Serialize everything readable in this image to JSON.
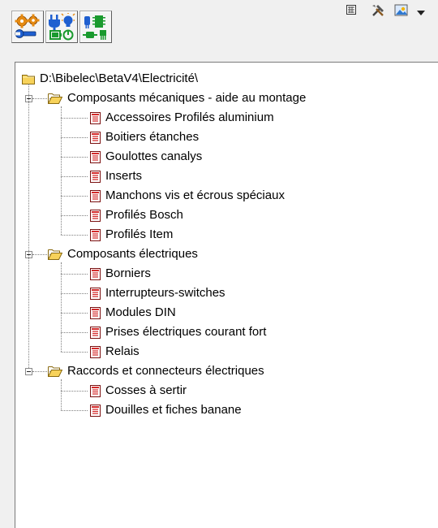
{
  "tree": {
    "root": {
      "label": "D:\\Bibelec\\BetaV4\\Electricité\\",
      "icon": "folder-icon"
    },
    "groups": [
      {
        "label": "Composants mécaniques - aide au montage",
        "icon": "folder-open-icon",
        "expanded": true,
        "items": [
          "Accessoires Profilés aluminium",
          "Boitiers étanches",
          "Goulottes canalys",
          "Inserts",
          "Manchons vis et écrous spéciaux",
          "Profilés Bosch",
          "Profilés Item"
        ]
      },
      {
        "label": "Composants électriques",
        "icon": "folder-open-icon",
        "expanded": true,
        "items": [
          "Borniers",
          "Interrupteurs-switches",
          "Modules DIN",
          "Prises électriques courant fort",
          "Relais"
        ]
      },
      {
        "label": "Raccords et connecteurs électriques",
        "icon": "folder-open-icon",
        "expanded": true,
        "items": [
          "Cosses à sertir",
          "Douilles et fiches banane"
        ]
      }
    ],
    "item_icon": "document-icon"
  },
  "toolbar": {
    "large_buttons": [
      {
        "icon": "mechanical-gears-wrench-icon"
      },
      {
        "icon": "electrical-plug-bulb-battery-icon"
      },
      {
        "icon": "electronic-components-icon"
      }
    ],
    "small_buttons": [
      {
        "icon": "grid-icon"
      },
      {
        "icon": "tools-icon"
      },
      {
        "icon": "image-icon"
      },
      {
        "icon": "dropdown-arrow-icon"
      }
    ]
  },
  "colors": {
    "folder_yellow": "#f7d25a",
    "document_red": "#d42a2a",
    "tree_line": "#808080",
    "toolbar_blue": "#1f5fd0",
    "toolbar_green": "#1a9a2e",
    "toolbar_orange": "#e58a12"
  }
}
